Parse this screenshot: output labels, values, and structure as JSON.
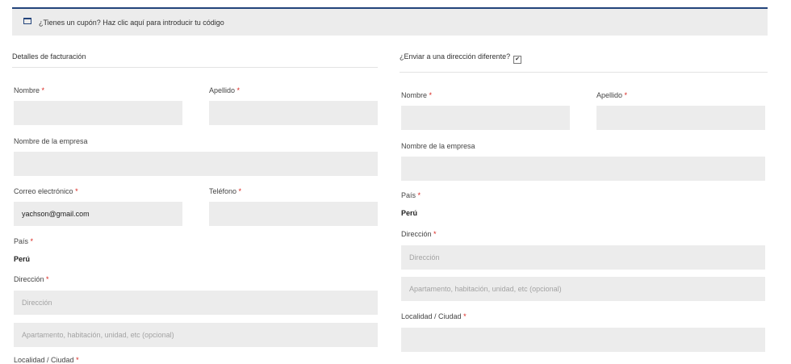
{
  "coupon": {
    "text": "¿Tienes un cupón? Haz clic aquí para introducir tu código",
    "icon": "coupon-icon"
  },
  "billing": {
    "title": "Detalles de facturación",
    "first_name_label": "Nombre",
    "last_name_label": "Apellido",
    "company_label": "Nombre de la empresa",
    "email_label": "Correo electrónico",
    "email_value": "yachson@gmail.com",
    "phone_label": "Teléfono",
    "country_label": "País",
    "country_value": "Perú",
    "address_label": "Dirección",
    "address_placeholder": "Dirección",
    "address2_placeholder": "Apartamento, habitación, unidad, etc (opcional)",
    "city_label": "Localidad / Ciudad"
  },
  "shipping": {
    "title": "¿Enviar a una dirección diferente?",
    "checkbox_mark": "✔",
    "first_name_label": "Nombre",
    "last_name_label": "Apellido",
    "company_label": "Nombre de la empresa",
    "country_label": "País",
    "country_value": "Perú",
    "address_label": "Dirección",
    "address_placeholder": "Dirección",
    "address2_placeholder": "Apartamento, habitación, unidad, etc (opcional)",
    "city_label": "Localidad / Ciudad"
  },
  "required_marker": "*",
  "colors": {
    "accent": "#23447b",
    "required": "#d9231d",
    "field_bg": "#ececec",
    "placeholder": "#a3a3a3"
  }
}
